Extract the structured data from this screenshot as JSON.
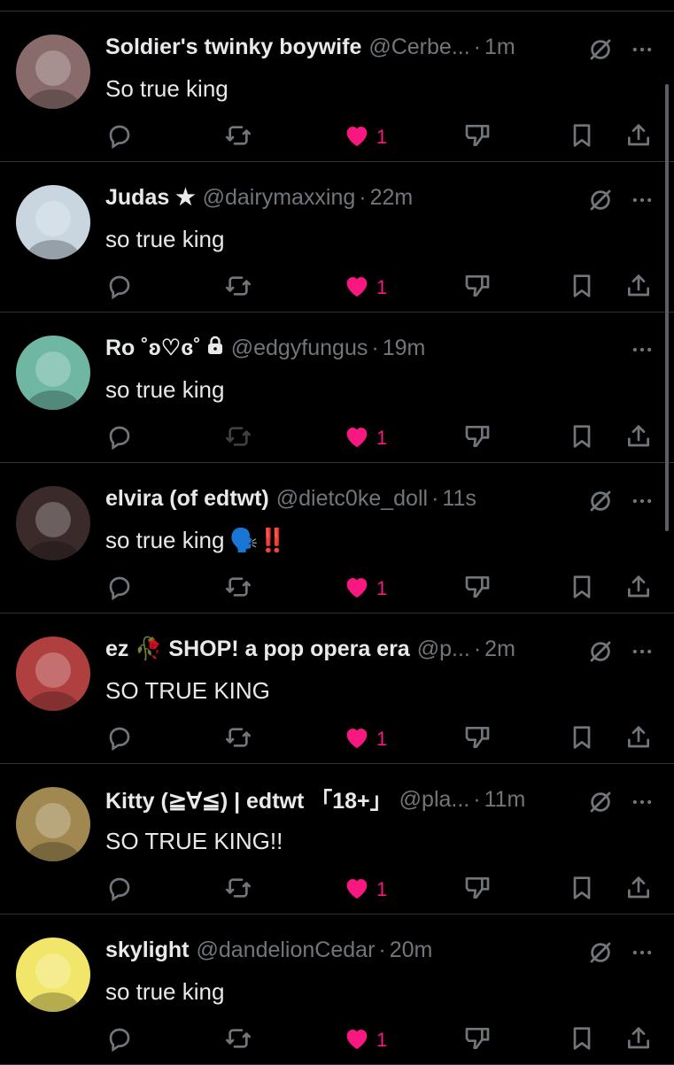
{
  "replies": [
    {
      "name": "Soldier's twinky boywife",
      "handle": "@Cerbe...",
      "sep": "·",
      "time": "1m",
      "text": "So true king",
      "likes": "1",
      "repost_active": true,
      "muted": true,
      "avatar_color": "#8a6b6b"
    },
    {
      "name": "Judas ★",
      "handle": "@dairymaxxing",
      "sep": "·",
      "time": "22m",
      "text": "so true king",
      "likes": "1",
      "repost_active": true,
      "muted": true,
      "avatar_color": "#c9d6e0"
    },
    {
      "name": "Ro ˚ʚ♡ɞ˚",
      "handle": "@edgyfungus",
      "sep": "·",
      "time": "19m",
      "text": "so true king",
      "likes": "1",
      "repost_active": false,
      "muted": false,
      "locked": true,
      "avatar_color": "#6fb7a3"
    },
    {
      "name": "elvira (of edtwt)",
      "handle": "@dietc0ke_doll",
      "sep": "·",
      "time": "11s",
      "text": "so true king",
      "text_emoji": "🗣️‼️",
      "likes": "1",
      "repost_active": true,
      "muted": true,
      "avatar_color": "#3a2a2a"
    },
    {
      "name": "ez 🥀 SHOP! a pop opera era",
      "handle": "@p...",
      "sep": "·",
      "time": "2m",
      "text": "SO TRUE KING",
      "likes": "1",
      "repost_active": true,
      "muted": true,
      "avatar_color": "#b04040"
    },
    {
      "name": "Kitty (≧∀≦) | edtwt 「18+」",
      "handle": "@pla...",
      "sep": "·",
      "time": "11m",
      "text": "SO TRUE KING!!",
      "likes": "1",
      "repost_active": true,
      "muted": true,
      "avatar_color": "#a08850"
    },
    {
      "name": "skylight",
      "handle": "@dandelionCedar",
      "sep": "·",
      "time": "20m",
      "text": "so true king",
      "likes": "1",
      "repost_active": true,
      "muted": true,
      "avatar_color": "#f2e66a"
    }
  ],
  "colors": {
    "like": "#f91880",
    "icon": "#71767b",
    "text": "#e7e9ea",
    "divider": "#2f3336"
  },
  "icons": {
    "reply": "reply-icon",
    "repost": "repost-icon",
    "like": "heart-icon",
    "dislike": "dislike-icon",
    "bookmark": "bookmark-icon",
    "share": "share-icon",
    "muted": "muted-icon",
    "more": "more-icon"
  }
}
